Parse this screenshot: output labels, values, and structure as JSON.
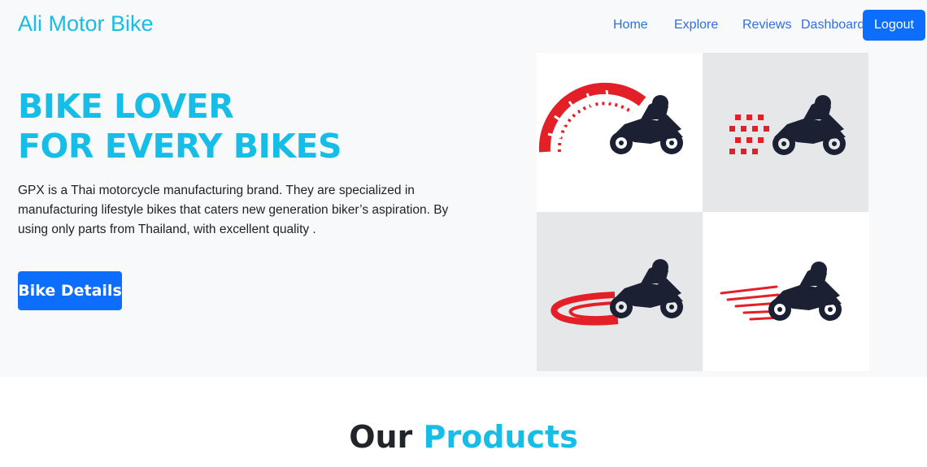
{
  "navbar": {
    "brand": "Ali Motor Bike",
    "links": [
      "Home",
      "Explore",
      "Reviews",
      "Dashboard"
    ],
    "logout_label": "Logout"
  },
  "hero": {
    "title_line1": "BIKE LOVER",
    "title_line2": "FOR EVERY BIKES",
    "description": "GPX is a Thai motorcycle manufacturing brand. They are specialized in manufacturing lifestyle bikes that caters new generation biker’s aspiration. By using only parts from Thailand, with excellent quality .",
    "button_label": "Bike Details"
  },
  "products": {
    "heading_word1": "Our",
    "heading_word2": "Products"
  },
  "colors": {
    "brand": "#16bde6",
    "primary_button": "#0d6efd",
    "nav_link": "#2f6fdc",
    "hero_bg": "#f8f9fa",
    "logo_red": "#e32028",
    "logo_dark": "#1b2033"
  },
  "gallery": [
    "speedometer-motorbike-logo",
    "checkered-flag-motorbike-logo",
    "swoosh-motorbike-logo",
    "speed-lines-motorbike-logo"
  ]
}
